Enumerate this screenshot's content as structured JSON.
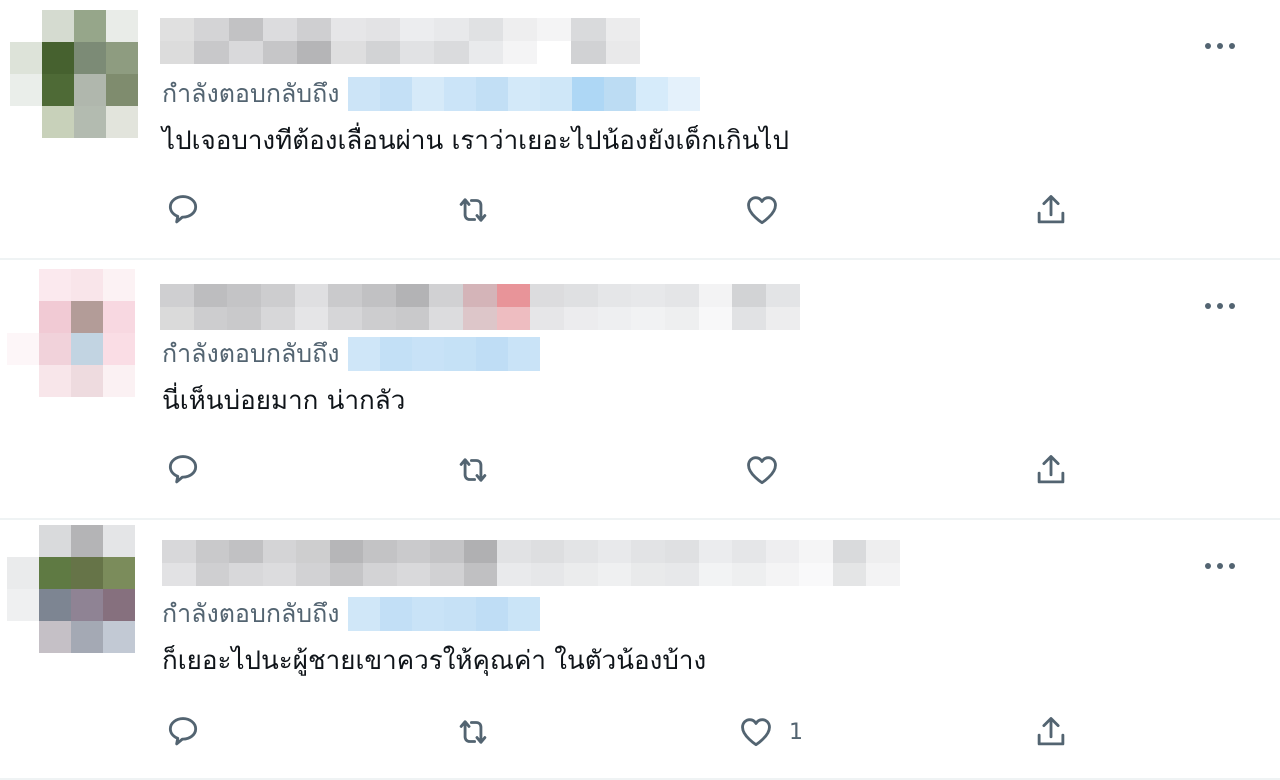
{
  "tweets": [
    {
      "reply_label": "กำลังตอบกลับถึง",
      "text": "ไปเจอบางทีต้องเลื่อนผ่าน เราว่าเยอะไปน้องยังเด็กเกินไป",
      "like_count": "",
      "avatar_colors": [
        "#ffffff",
        "#d5dbd0",
        "#96a68a",
        "#e9ece8",
        "#dde3d9",
        "#46612f",
        "#7c8b76",
        "#8e9c80",
        "#eaeeea",
        "#4e6a36",
        "#b0b7ad",
        "#7f8c6e",
        "#ffffff",
        "#c8d1ba",
        "#b3bbb0",
        "#e2e4dc"
      ],
      "name_colors": [
        [
          "#e0e0e0",
          "#d4d4d6",
          "#c2c2c4",
          "#dcdcde",
          "#cfcfd1",
          "#e6e6e8",
          "#e3e3e5",
          "#ecedef",
          "#e8e9eb",
          "#e0e1e3",
          "#eeeeef",
          "#f4f4f5",
          "#d9dadc",
          "#ececed"
        ],
        [
          "#dcdcdc",
          "#c8c8ca",
          "#d9d9db",
          "#c6c6c8",
          "#b5b5b7",
          "#dededf",
          "#d2d3d5",
          "#e1e2e4",
          "#dadbdd",
          "#e9eaec",
          "#f4f4f5",
          "#ffffff",
          "#d1d2d4",
          "#e9e9ea"
        ]
      ],
      "mention_colors": [
        "#cce4f7",
        "#c4e0f6",
        "#d6eaf9",
        "#cbe4f8",
        "#c2dff5",
        "#d3e9f9",
        "#cfe7f8",
        "#aed7f5",
        "#bcdcf3",
        "#d6ebfa",
        "#e4f1fb"
      ]
    },
    {
      "reply_label": "กำลังตอบกลับถึง",
      "text": "นี่เห็นบ่อยมาก น่ากลัว",
      "like_count": "",
      "avatar_colors": [
        "#ffffff",
        "#fbe9ee",
        "#f9e5ea",
        "#fcf2f4",
        "#ffffff",
        "#f1cad4",
        "#b39c98",
        "#f8d8e1",
        "#fdf6f8",
        "#f1d2da",
        "#c2d4e2",
        "#fadde5",
        "#ffffff",
        "#f8e6ea",
        "#eedbdf",
        "#fbf1f3"
      ],
      "name_colors": [
        [
          "#cfcfd1",
          "#bdbdbf",
          "#c4c4c6",
          "#cdcdcf",
          "#dfdfe1",
          "#cacacc",
          "#c1c1c3",
          "#b3b3b5",
          "#d1d1d3",
          "#d4b4b8",
          "#e89499",
          "#dcdcde",
          "#dfe0e2",
          "#e5e6e8",
          "#e7e8ea",
          "#e4e5e7",
          "#f3f3f4",
          "#d2d3d5",
          "#e3e4e6"
        ],
        [
          "#dadada",
          "#cdcdcf",
          "#c9c9cb",
          "#d7d7d9",
          "#e5e5e7",
          "#d6d6d8",
          "#cdcdcf",
          "#c9c9cb",
          "#dcdcde",
          "#ddc6c9",
          "#eebdc1",
          "#e6e6e8",
          "#ececee",
          "#eeeff1",
          "#f1f2f3",
          "#eeeff0",
          "#f8f8f9",
          "#e1e2e4",
          "#ededee"
        ]
      ],
      "mention_colors": [
        "#cfe6f8",
        "#c3e0f6",
        "#c8e2f7",
        "#c5e1f6",
        "#bfddf5",
        "#c9e3f7"
      ]
    },
    {
      "reply_label": "กำลังตอบกลับถึง",
      "text": "ก็เยอะไปนะผู้ชายเขาควรให้คุณค่า ในตัวน้องบ้าง",
      "like_count": "1",
      "avatar_colors": [
        "#ffffff",
        "#d9dadc",
        "#b4b4b6",
        "#e4e5e7",
        "#eaebec",
        "#5f7a43",
        "#667448",
        "#7b8c5b",
        "#eff0f1",
        "#7d8592",
        "#8f8394",
        "#86707e",
        "#ffffff",
        "#c5c0c6",
        "#a4a9b4",
        "#c2c9d4"
      ],
      "name_colors": [
        [
          "#d8d8da",
          "#c9c9cb",
          "#c1c1c3",
          "#d4d4d6",
          "#cececf",
          "#b6b6b8",
          "#c3c3c5",
          "#cacacc",
          "#c4c4c6",
          "#b0b0b2",
          "#e1e2e4",
          "#dddee0",
          "#e3e4e6",
          "#e8e9eb",
          "#e2e3e5",
          "#dfe0e2",
          "#ebecee",
          "#e5e6e8",
          "#eeeef0",
          "#f5f5f6",
          "#d9dadc",
          "#eeeeef"
        ],
        [
          "#e2e2e4",
          "#cfcfd1",
          "#d8d8da",
          "#dcdcde",
          "#d2d2d4",
          "#c5c5c7",
          "#d3d3d5",
          "#d9d9db",
          "#d1d1d3",
          "#c0c0c2",
          "#e9eaec",
          "#e6e7e9",
          "#ebeced",
          "#eff0f1",
          "#e9eaeb",
          "#e7e8ea",
          "#f2f3f4",
          "#eeeff0",
          "#f4f4f5",
          "#f9f9fa",
          "#e4e5e6",
          "#f3f3f4"
        ]
      ],
      "mention_colors": [
        "#d0e7f8",
        "#c2dff6",
        "#c9e3f7",
        "#c6e1f6",
        "#bfddf5",
        "#cae4f7"
      ]
    }
  ]
}
